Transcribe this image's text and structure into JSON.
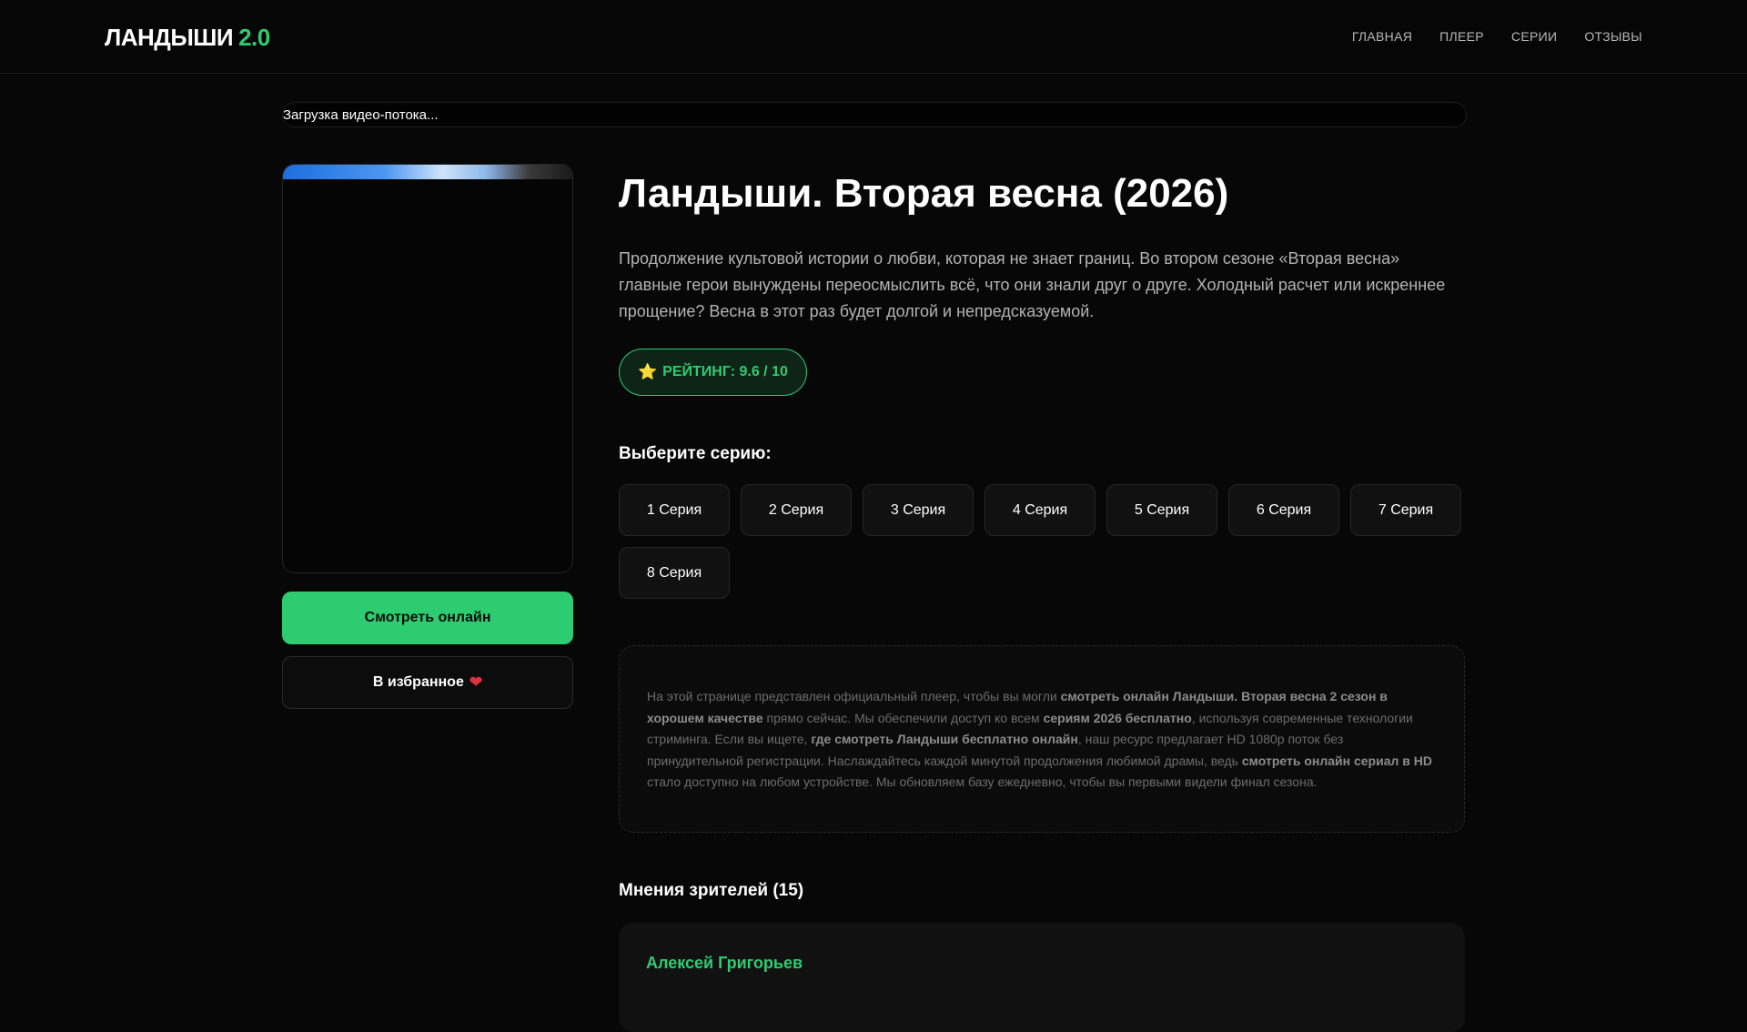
{
  "header": {
    "logo_text": "ЛАНДЫШИ",
    "logo_version": "2.0",
    "nav": [
      "ГЛАВНАЯ",
      "ПЛЕЕР",
      "СЕРИИ",
      "ОТЗЫВЫ"
    ]
  },
  "player": {
    "loading_text": "Загрузка видео-потока..."
  },
  "actions": {
    "watch_label": "Смотреть онлайн",
    "favorite_label": "В избранное",
    "favorite_icon": "heart-icon"
  },
  "show": {
    "title": "Ландыши. Вторая весна (2026)",
    "description": "Продолжение культовой истории о любви, которая не знает границ. Во втором сезоне «Вторая весна» главные герои вынуждены переосмыслить всё, что они знали друг о друге. Холодный расчет или искреннее прощение? Весна в этот раз будет долгой и непредсказуемой.",
    "rating_label": "РЕЙТИНГ: 9.6 / 10",
    "rating_icon": "star-icon"
  },
  "episodes": {
    "heading": "Выберите серию:",
    "items": [
      "1 Серия",
      "2 Серия",
      "3 Серия",
      "4 Серия",
      "5 Серия",
      "6 Серия",
      "7 Серия",
      "8 Серия"
    ]
  },
  "seo": {
    "parts": [
      {
        "text": "На этой странице представлен официальный плеер, чтобы вы могли ",
        "bold": false
      },
      {
        "text": "смотреть онлайн Ландыши. Вторая весна 2 сезон в хорошем качестве",
        "bold": true
      },
      {
        "text": " прямо сейчас. Мы обеспечили доступ ко всем ",
        "bold": false
      },
      {
        "text": "сериям 2026 бесплатно",
        "bold": true
      },
      {
        "text": ", используя современные технологии стриминга. Если вы ищете, ",
        "bold": false
      },
      {
        "text": "где смотреть Ландыши бесплатно онлайн",
        "bold": true
      },
      {
        "text": ", наш ресурс предлагает HD 1080p поток без принудительной регистрации. Наслаждайтесь каждой минутой продолжения любимой драмы, ведь ",
        "bold": false
      },
      {
        "text": "смотреть онлайн сериал в HD",
        "bold": true
      },
      {
        "text": " стало доступно на любом устройстве. Мы обновляем базу ежедневно, чтобы вы первыми видели финал сезона.",
        "bold": false
      }
    ]
  },
  "reviews": {
    "heading": "Мнения зрителей (15)",
    "first_author": "Алексей Григорьев"
  },
  "colors": {
    "accent": "#2ecc71",
    "background": "#070707"
  }
}
